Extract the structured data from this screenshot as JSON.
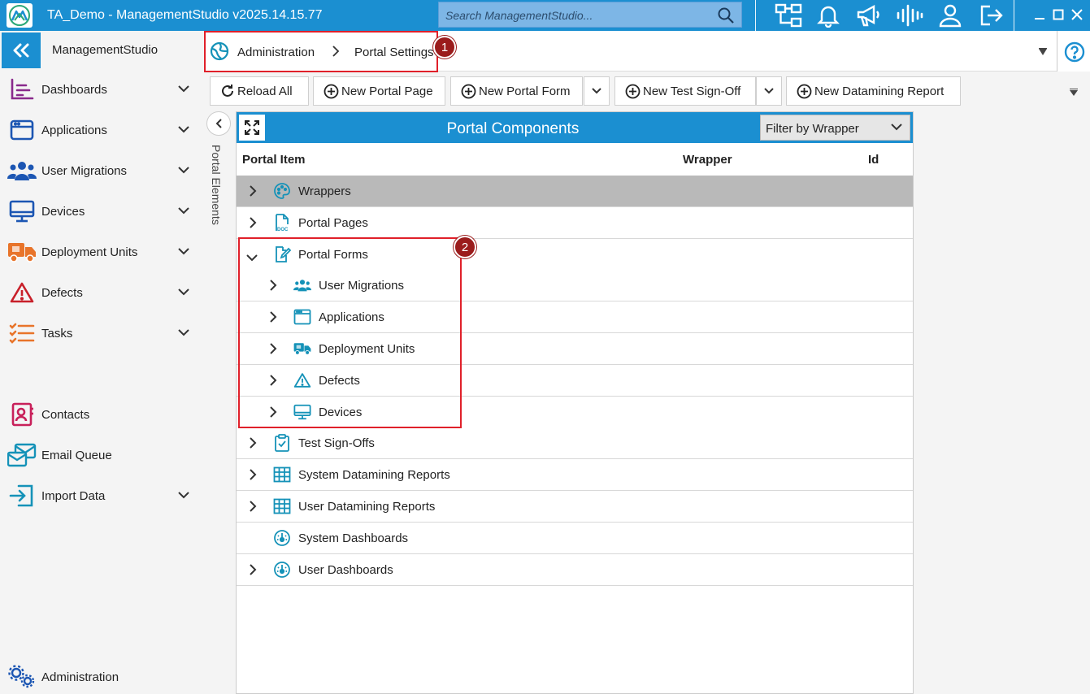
{
  "titlebar": {
    "title": "TA_Demo - ManagementStudio v2025.14.15.77",
    "search_placeholder": "Search ManagementStudio..."
  },
  "sidebar": {
    "brand": "ManagementStudio",
    "items": [
      {
        "label": "Dashboards",
        "icon": "dashboards-icon",
        "expandable": true
      },
      {
        "label": "Applications",
        "icon": "applications-icon",
        "expandable": true
      },
      {
        "label": "User Migrations",
        "icon": "users-icon",
        "expandable": true
      },
      {
        "label": "Devices",
        "icon": "monitor-icon",
        "expandable": true
      },
      {
        "label": "Deployment Units",
        "icon": "truck-icon",
        "expandable": true
      },
      {
        "label": "Defects",
        "icon": "warning-icon",
        "expandable": true
      },
      {
        "label": "Tasks",
        "icon": "tasks-icon",
        "expandable": true
      },
      {
        "label": "Contacts",
        "icon": "contacts-icon",
        "expandable": false
      },
      {
        "label": "Email Queue",
        "icon": "email-queue-icon",
        "expandable": false
      },
      {
        "label": "Import Data",
        "icon": "import-icon",
        "expandable": true
      },
      {
        "label": "Administration",
        "icon": "gears-icon",
        "expandable": false
      }
    ]
  },
  "breadcrumb": {
    "items": [
      "Administration",
      "Portal Settings"
    ]
  },
  "toolbar": {
    "reload": "Reload All",
    "new_page": "New Portal Page",
    "new_form": "New Portal Form",
    "new_signoff": "New Test Sign-Off",
    "new_report": "New Datamining Report"
  },
  "side_tab": {
    "label": "Portal Elements"
  },
  "grid": {
    "title": "Portal Components",
    "filter": "Filter by Wrapper",
    "columns": [
      "Portal Item",
      "Wrapper",
      "Id"
    ],
    "rows": [
      {
        "label": "Wrappers",
        "icon": "palette-icon",
        "level": 0,
        "expander": "collapsed",
        "selected": true
      },
      {
        "label": "Portal Pages",
        "icon": "document-icon",
        "level": 0,
        "expander": "collapsed",
        "selected": false
      },
      {
        "label": "Portal Forms",
        "icon": "form-edit-icon",
        "level": 0,
        "expander": "expanded",
        "selected": false
      },
      {
        "label": "User Migrations",
        "icon": "users-icon",
        "level": 1,
        "expander": "collapsed",
        "selected": false
      },
      {
        "label": "Applications",
        "icon": "window-icon",
        "level": 1,
        "expander": "collapsed",
        "selected": false
      },
      {
        "label": "Deployment Units",
        "icon": "truck-icon",
        "level": 1,
        "expander": "collapsed",
        "selected": false
      },
      {
        "label": "Defects",
        "icon": "warning-icon",
        "level": 1,
        "expander": "collapsed",
        "selected": false
      },
      {
        "label": "Devices",
        "icon": "monitor-icon",
        "level": 1,
        "expander": "collapsed",
        "selected": false
      },
      {
        "label": "Test Sign-Offs",
        "icon": "clipboard-check-icon",
        "level": 0,
        "expander": "collapsed",
        "selected": false
      },
      {
        "label": "System Datamining Reports",
        "icon": "grid-table-icon",
        "level": 0,
        "expander": "collapsed",
        "selected": false
      },
      {
        "label": "User Datamining Reports",
        "icon": "grid-table-icon",
        "level": 0,
        "expander": "collapsed",
        "selected": false
      },
      {
        "label": "System Dashboards",
        "icon": "gauge-icon",
        "level": 0,
        "expander": "none",
        "selected": false
      },
      {
        "label": "User Dashboards",
        "icon": "gauge-icon",
        "level": 0,
        "expander": "collapsed",
        "selected": false
      }
    ]
  },
  "annotations": {
    "badge1": "1",
    "badge2": "2"
  },
  "colors": {
    "accent": "#1b8fd1",
    "annotation": "#e0202a",
    "badge": "#9b1c1c",
    "selected_row": "#b9b9b9",
    "icon_teal": "#1592b8"
  }
}
